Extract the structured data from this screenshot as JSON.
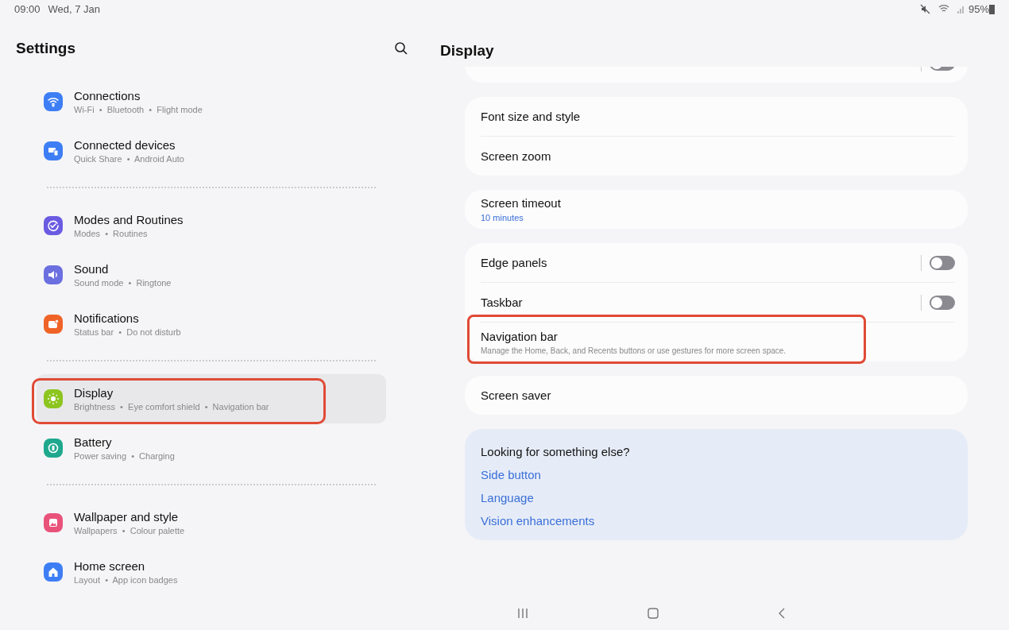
{
  "status_bar": {
    "time": "09:00",
    "date": "Wed, 7 Jan",
    "battery": "95%"
  },
  "sidebar": {
    "title": "Settings",
    "groups": [
      {
        "items": [
          {
            "title": "Connections",
            "subtitle": "Wi-Fi  •  Bluetooth  •  Flight mode",
            "kind": "wifi",
            "color": "#3d7ef5",
            "selected": false,
            "highlighted": false
          },
          {
            "title": "Connected devices",
            "subtitle": "Quick Share  •  Android Auto",
            "kind": "devices",
            "color": "#3d7ef5",
            "selected": false,
            "highlighted": false
          }
        ]
      },
      {
        "items": [
          {
            "title": "Modes and Routines",
            "subtitle": "Modes  •  Routines",
            "kind": "check",
            "color": "#6b5be2",
            "selected": false,
            "highlighted": false
          },
          {
            "title": "Sound",
            "subtitle": "Sound mode  •  Ringtone",
            "kind": "speaker",
            "color": "#6b6fe0",
            "selected": false,
            "highlighted": false
          },
          {
            "title": "Notifications",
            "subtitle": "Status bar  •  Do not disturb",
            "kind": "bell",
            "color": "#ef6327",
            "selected": false,
            "highlighted": false
          }
        ]
      },
      {
        "items": [
          {
            "title": "Display",
            "subtitle": "Brightness  •  Eye comfort shield  •  Navigation bar",
            "kind": "sun",
            "color": "#8dc51f",
            "selected": true,
            "highlighted": true
          },
          {
            "title": "Battery",
            "subtitle": "Power saving  •  Charging",
            "kind": "battery",
            "color": "#1ea88e",
            "selected": false,
            "highlighted": false
          }
        ]
      },
      {
        "items": [
          {
            "title": "Wallpaper and style",
            "subtitle": "Wallpapers  •  Colour palette",
            "kind": "image",
            "color": "#e9527a",
            "selected": false,
            "highlighted": false
          },
          {
            "title": "Home screen",
            "subtitle": "Layout  •  App icon badges",
            "kind": "home",
            "color": "#3d7ef5",
            "selected": false,
            "highlighted": false
          }
        ]
      }
    ]
  },
  "content": {
    "title": "Display",
    "partial_card": {
      "toggle_on": false
    },
    "cards": [
      {
        "rows": [
          {
            "kind": "link",
            "title": "Font size and style",
            "highlighted": false
          },
          {
            "kind": "link",
            "title": "Screen zoom",
            "highlighted": false
          }
        ]
      },
      {
        "rows": [
          {
            "kind": "link",
            "title": "Screen timeout",
            "value": "10 minutes",
            "highlighted": false
          }
        ]
      },
      {
        "rows": [
          {
            "kind": "toggle",
            "title": "Edge panels",
            "on": false,
            "highlighted": false
          },
          {
            "kind": "toggle",
            "title": "Taskbar",
            "on": false,
            "highlighted": false
          },
          {
            "kind": "link",
            "title": "Navigation bar",
            "description": "Manage the Home, Back, and Recents buttons or use gestures for more screen space.",
            "highlighted": true
          }
        ]
      },
      {
        "rows": [
          {
            "kind": "link",
            "title": "Screen saver",
            "highlighted": false
          }
        ]
      }
    ],
    "suggestions": {
      "title": "Looking for something else?",
      "links": [
        "Side button",
        "Language",
        "Vision enhancements"
      ]
    }
  }
}
